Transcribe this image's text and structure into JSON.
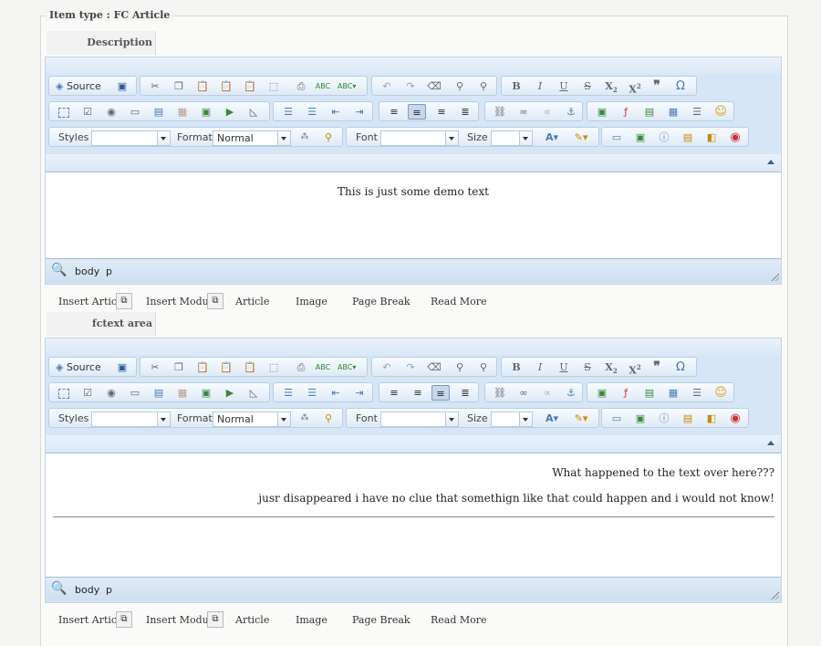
{
  "fieldset": {
    "legend": "Item type : FC Article"
  },
  "fields": [
    {
      "label": "Description",
      "content_lines": [
        "This is just some demo text"
      ],
      "align": "center"
    },
    {
      "label": "fctext area",
      "content_lines": [
        "What happened to the text over here???",
        "jusr disappeared i have no clue that somethign like that could happen and i would not know!"
      ],
      "align": "right"
    }
  ],
  "toolbar": {
    "source_label": "Source",
    "styles_label": "Styles",
    "format_label": "Format",
    "format_value": "Normal",
    "font_label": "Font",
    "size_label": "Size"
  },
  "statusbar": {
    "path_body": "body",
    "path_p": "p"
  },
  "editor_buttons": {
    "insert_article": "Insert Article",
    "insert_module": "Insert Module",
    "article": "Article",
    "image": "Image",
    "page_break": "Page Break",
    "read_more": "Read More"
  },
  "colors": {
    "toolbar_bg": "#dbe8f6",
    "border": "#a8bbd3",
    "page_bg": "#f5f5f4"
  }
}
